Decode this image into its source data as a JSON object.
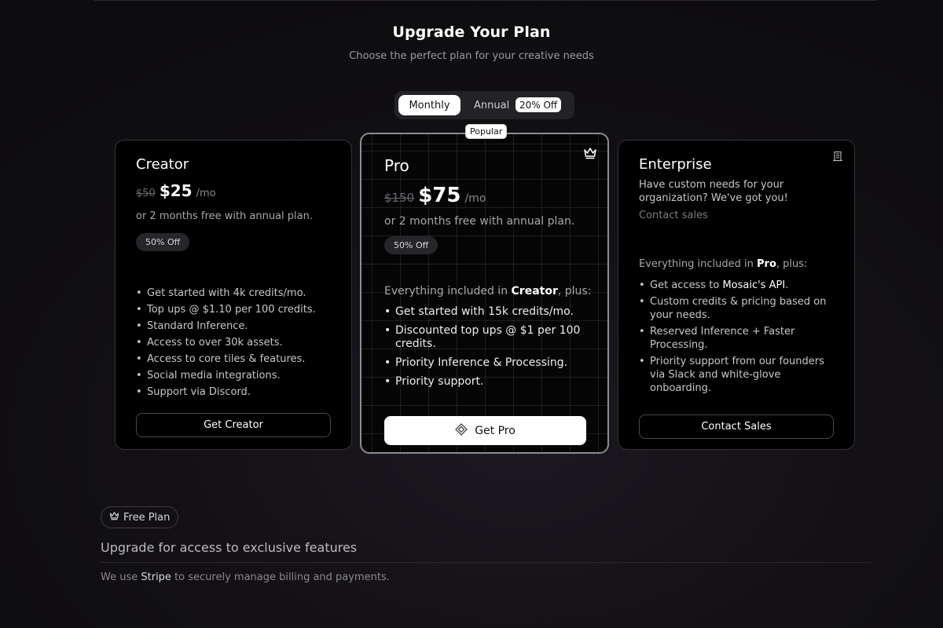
{
  "header": {
    "title": "Upgrade Your Plan",
    "subtitle": "Choose the perfect plan for your creative needs"
  },
  "billing_toggle": {
    "monthly_label": "Monthly",
    "annual_label": "Annual",
    "annual_discount_badge": "20% Off",
    "selected": "Monthly"
  },
  "plans": {
    "creator": {
      "name": "Creator",
      "old_price": "$50",
      "price": "$25",
      "period": "/mo",
      "annual_note": "or 2 months free with annual plan.",
      "discount_pill": "50% Off",
      "features": [
        "Get started with 4k credits/mo.",
        "Top ups @ $1.10 per 100 credits.",
        "Standard Inference.",
        "Access to over 30k assets.",
        "Access to core tiles & features.",
        "Social media integrations.",
        "Support via Discord."
      ],
      "button_label": "Get Creator"
    },
    "pro": {
      "popular_badge": "Popular",
      "corner_icon": "crown-icon",
      "name": "Pro",
      "old_price": "$150",
      "price": "$75",
      "period": "/mo",
      "annual_note": "or 2 months free with annual plan.",
      "discount_pill": "50% Off",
      "intro_prefix": "Everything included in",
      "intro_plan": "Creator",
      "intro_suffix": ", plus:",
      "features": [
        "Get started with 15k credits/mo.",
        "Discounted top ups @ $1 per 100 credits.",
        "Priority Inference & Processing.",
        "Priority support."
      ],
      "button_icon": "diamond-icon",
      "button_label": "Get Pro"
    },
    "enterprise": {
      "name": "Enterprise",
      "corner_icon": "building-icon",
      "description": "Have custom needs for your organization? We've got you!",
      "contact_text": "Contact sales",
      "intro_prefix": "Everything included in",
      "intro_plan": "Pro",
      "intro_suffix": ", plus:",
      "features_first_prefix": "Get access to",
      "features_first_highlight": "Mosaic's API",
      "features_first_suffix": ".",
      "features": [
        "Custom credits & pricing based on your needs.",
        "Reserved Inference + Faster Processing.",
        "Priority support from our founders via Slack and white-glove onboarding."
      ],
      "button_label": "Contact Sales"
    }
  },
  "footer": {
    "current_plan_icon": "crown-icon",
    "current_plan_label": "Free Plan",
    "upgrade_text": "Upgrade for access to exclusive features",
    "stripe_prefix": "We use",
    "stripe_link": "Stripe",
    "stripe_suffix": "to securely manage billing and payments."
  }
}
